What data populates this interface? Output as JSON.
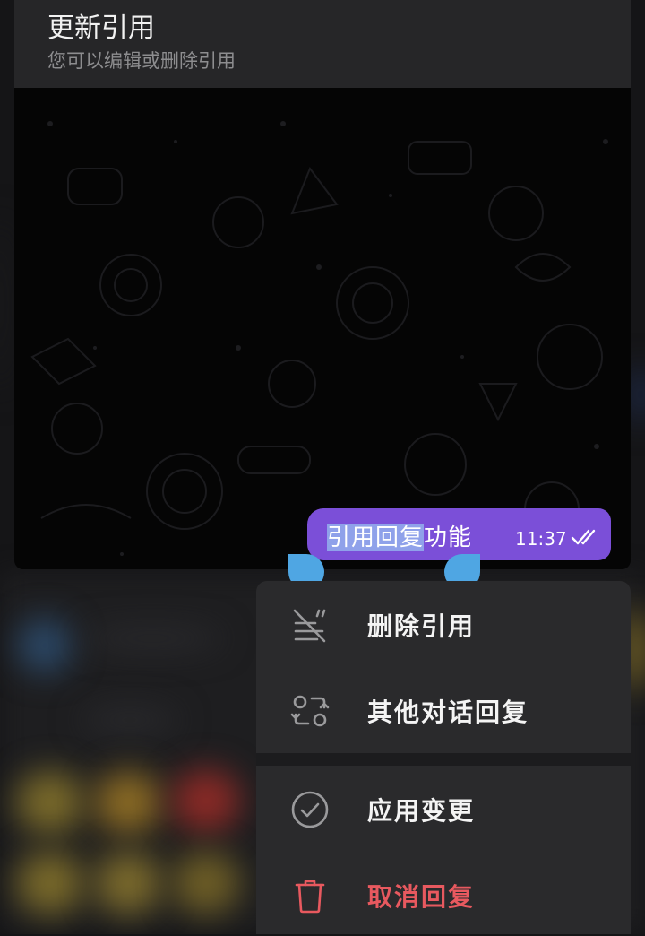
{
  "header": {
    "title": "更新引用",
    "subtitle": "您可以编辑或删除引用"
  },
  "message": {
    "text_selected": "引用回复",
    "text_rest": "功能",
    "time": "11:37",
    "status": "read-double-check",
    "bubble_color": "#7b4fd8",
    "selection_color": "#8fa1ea",
    "handle_color": "#4fa6e3"
  },
  "menu": {
    "items": [
      {
        "label": "删除引用",
        "icon": "remove-quote-icon"
      },
      {
        "label": "其他对话回复",
        "icon": "reply-other-chat-icon"
      }
    ],
    "actions": [
      {
        "label": "应用变更",
        "icon": "check-circle-icon"
      },
      {
        "label": "取消回复",
        "icon": "trash-icon",
        "color": "#e8595f"
      }
    ]
  }
}
